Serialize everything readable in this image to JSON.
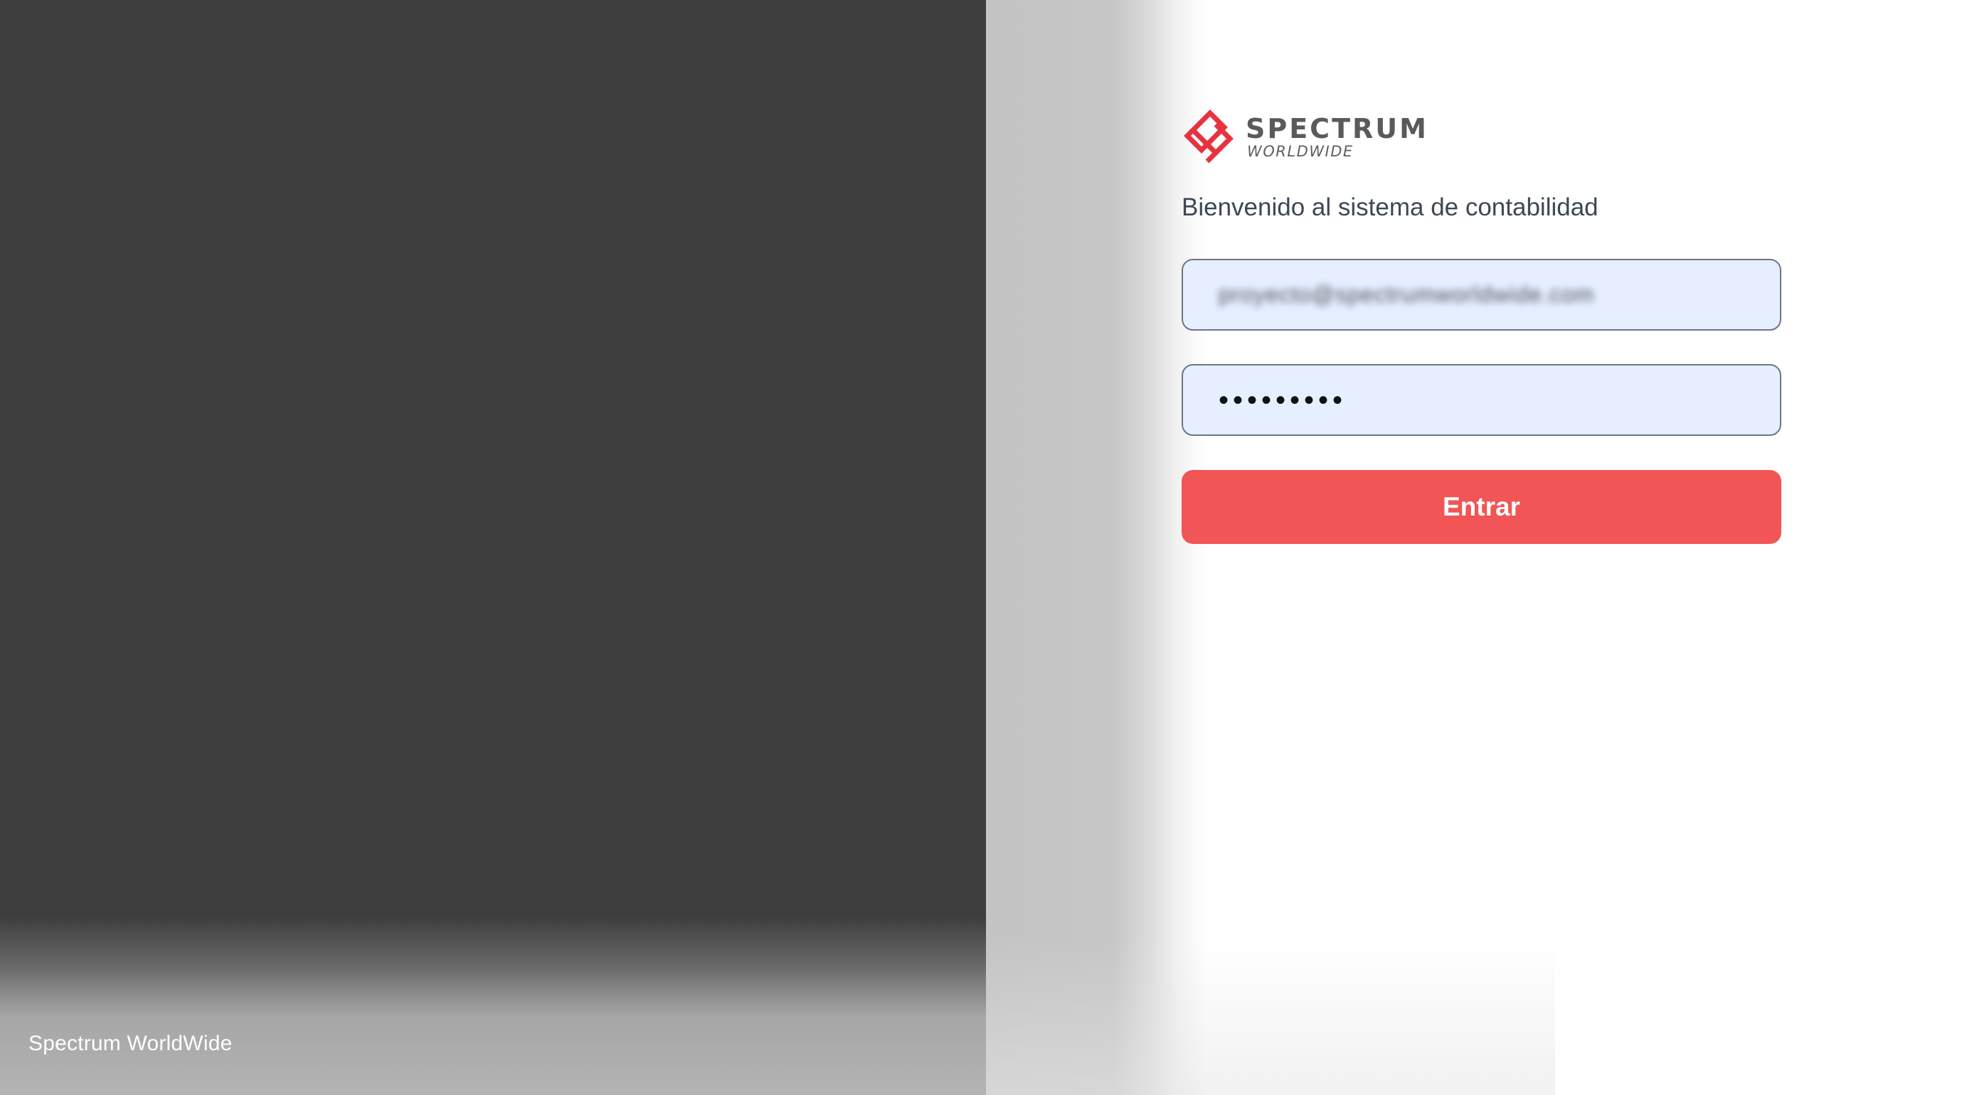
{
  "branding": {
    "name": "SPECTRUM",
    "subtitle": "WORLDWIDE",
    "footer": "Spectrum WorldWide"
  },
  "login": {
    "welcome": "Bienvenido al sistema de contabilidad",
    "email_value": "proyecto@spectrumworldwide.com",
    "email_value_blurred": true,
    "password_masked": "•••••••••",
    "submit_label": "Entrar"
  },
  "colors": {
    "accent": "#f15555",
    "logo_red": "#e8323f",
    "input_bg": "#e6efff",
    "panel_dark": "#3e3e3e"
  },
  "icons": {
    "logo": "spectrum-logo-icon"
  }
}
